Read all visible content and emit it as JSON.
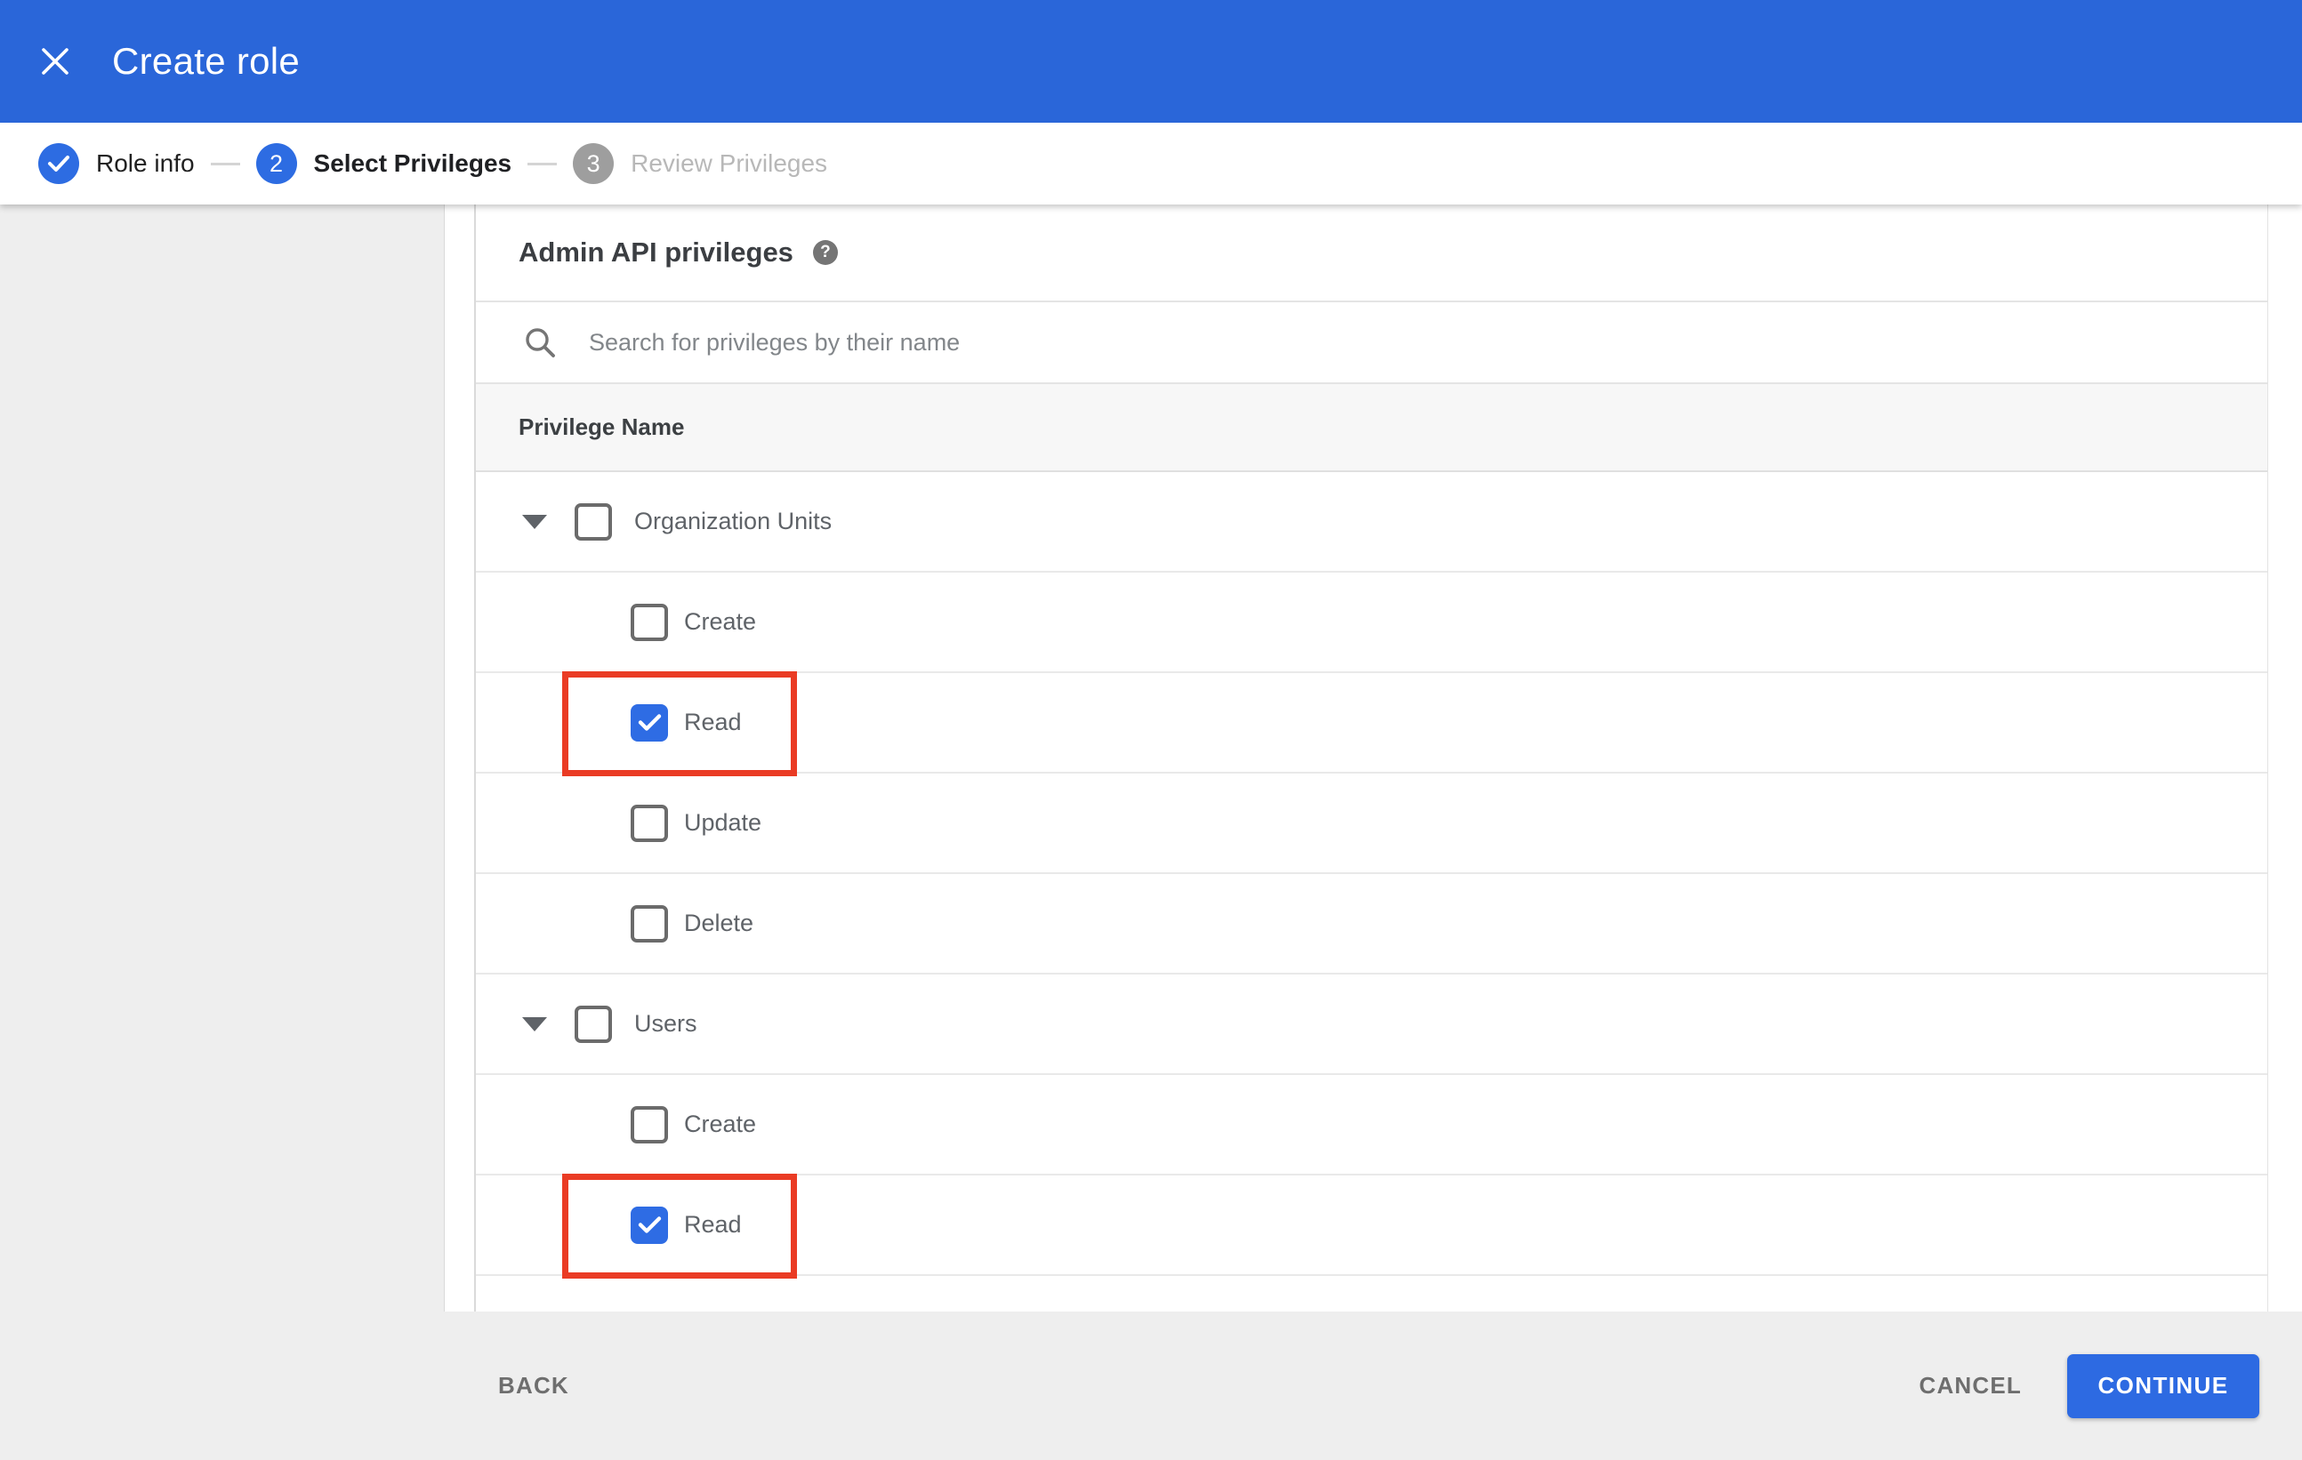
{
  "app": {
    "title": "Create role"
  },
  "stepper": {
    "steps": [
      {
        "number": "",
        "label": "Role info",
        "status": "complete"
      },
      {
        "number": "2",
        "label": "Select Privileges",
        "status": "active"
      },
      {
        "number": "3",
        "label": "Review Privileges",
        "status": "upcoming"
      }
    ]
  },
  "privileges_panel": {
    "heading": "Admin API privileges",
    "help_icon_glyph": "?",
    "search": {
      "value": "",
      "placeholder": "Search for privileges by their name"
    },
    "table": {
      "header": "Privilege Name",
      "rows": [
        {
          "label": "Organization Units",
          "type": "group",
          "checked": false,
          "expanded": true
        },
        {
          "label": "Create",
          "type": "child",
          "checked": false
        },
        {
          "label": "Read",
          "type": "child",
          "checked": true,
          "highlighted": true
        },
        {
          "label": "Update",
          "type": "child",
          "checked": false
        },
        {
          "label": "Delete",
          "type": "child",
          "checked": false
        },
        {
          "label": "Users",
          "type": "group",
          "checked": false,
          "expanded": true
        },
        {
          "label": "Create",
          "type": "child",
          "checked": false
        },
        {
          "label": "Read",
          "type": "child",
          "checked": true,
          "highlighted": true
        }
      ]
    }
  },
  "footer": {
    "back_label": "BACK",
    "cancel_label": "CANCEL",
    "continue_label": "CONTINUE"
  },
  "colors": {
    "appbar_blue": "#2a66d9",
    "accent_blue": "#2d6ce2",
    "checkbox_blue": "#2e6ce4",
    "step_inactive_gray": "#9e9e9e",
    "annotation_red": "#ea3b24",
    "footer_gray": "#eeeeee"
  }
}
